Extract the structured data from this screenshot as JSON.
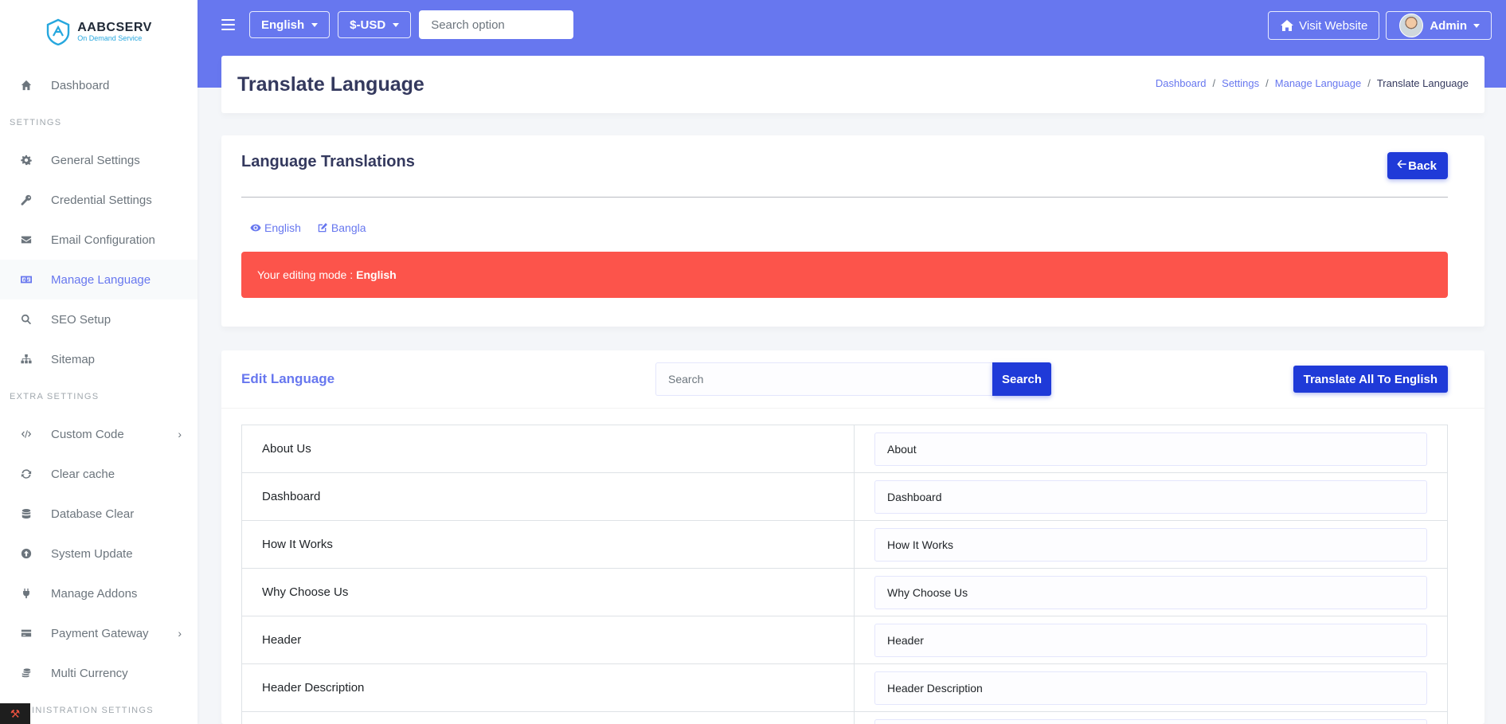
{
  "brand": {
    "name": "AABCSERV",
    "tagline": "On Demand Service"
  },
  "sidebar": {
    "top_items": [
      {
        "label": "Dashboard",
        "icon": "home-icon"
      }
    ],
    "sections": [
      {
        "header": "SETTINGS",
        "items": [
          {
            "label": "General Settings",
            "icon": "gear-icon"
          },
          {
            "label": "Credential Settings",
            "icon": "key-icon"
          },
          {
            "label": "Email Configuration",
            "icon": "envelope-icon"
          },
          {
            "label": "Manage Language",
            "icon": "language-icon",
            "active": true
          },
          {
            "label": "SEO Setup",
            "icon": "search-icon"
          },
          {
            "label": "Sitemap",
            "icon": "sitemap-icon"
          }
        ]
      },
      {
        "header": "EXTRA SETTINGS",
        "items": [
          {
            "label": "Custom Code",
            "icon": "code-icon",
            "has_submenu": true
          },
          {
            "label": "Clear cache",
            "icon": "sync-icon"
          },
          {
            "label": "Database Clear",
            "icon": "database-icon"
          },
          {
            "label": "System Update",
            "icon": "upload-icon"
          },
          {
            "label": "Manage Addons",
            "icon": "plug-icon"
          },
          {
            "label": "Payment Gateway",
            "icon": "credit-card-icon",
            "has_submenu": true
          },
          {
            "label": "Multi Currency",
            "icon": "coins-icon"
          }
        ]
      }
    ],
    "bottom_header_partial": "INISTRATION SETTINGS"
  },
  "topnav": {
    "language": "English",
    "currency": "$-USD",
    "search_placeholder": "Search option",
    "visit_website": "Visit Website",
    "admin": "Admin"
  },
  "page": {
    "title": "Translate Language",
    "breadcrumb": [
      "Dashboard",
      "Settings",
      "Manage Language",
      "Translate Language"
    ]
  },
  "translations_card": {
    "title": "Language Translations",
    "back_label": "Back",
    "languages": [
      {
        "label": "English",
        "icon": "eye-icon"
      },
      {
        "label": "Bangla",
        "icon": "edit-icon"
      }
    ],
    "alert_prefix": "Your editing mode :",
    "alert_language": "English",
    "alert_color": "#fc544b"
  },
  "edit_card": {
    "title": "Edit Language",
    "search_placeholder": "Search",
    "search_button": "Search",
    "translate_all": "Translate All To English",
    "rows": [
      {
        "key": "About Us",
        "value": "About"
      },
      {
        "key": "Dashboard",
        "value": "Dashboard"
      },
      {
        "key": "How It Works",
        "value": "How It Works"
      },
      {
        "key": "Why Choose Us",
        "value": "Why Choose Us"
      },
      {
        "key": "Header",
        "value": "Header"
      },
      {
        "key": "Header Description",
        "value": "Header Description"
      },
      {
        "key": "",
        "value": ""
      }
    ]
  },
  "colors": {
    "primary": "#6777ef",
    "button": "#1f3ad8",
    "danger": "#fc544b"
  }
}
